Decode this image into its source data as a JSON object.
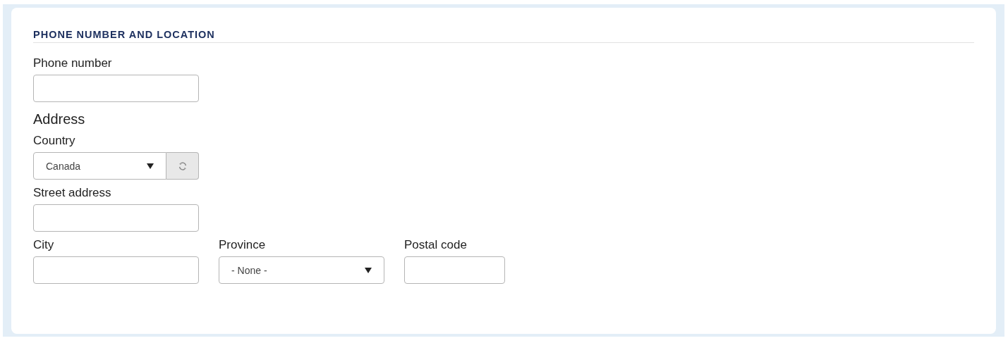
{
  "section": {
    "title": "PHONE NUMBER AND LOCATION"
  },
  "rows": [
    {
      "items": [
        {
          "kind": "text",
          "label": "Phone number"
        }
      ]
    },
    {
      "items": [
        {
          "kind": "heading",
          "label": "Address"
        }
      ]
    },
    {
      "items": [
        {
          "kind": "select_refresh",
          "label": "Country",
          "value": "Canada"
        }
      ]
    },
    {
      "items": [
        {
          "kind": "text",
          "label": "Street address"
        }
      ]
    },
    {
      "items": [
        {
          "kind": "text",
          "label": "City"
        },
        {
          "kind": "select",
          "label": "Province",
          "value": "- None -"
        },
        {
          "kind": "text",
          "label": "Postal code"
        }
      ]
    }
  ]
}
